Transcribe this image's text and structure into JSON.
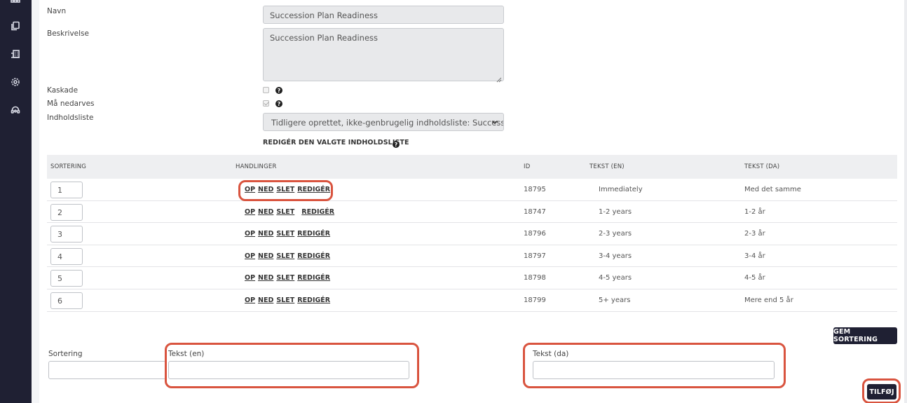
{
  "sidebar": {
    "icons": [
      "grid-icon",
      "documents-icon",
      "building-icon",
      "gear-icon",
      "support-icon"
    ]
  },
  "form": {
    "name_label": "Navn",
    "name_value": "Succession Plan Readiness",
    "description_label": "Beskrivelse",
    "description_value": "Succession Plan Readiness",
    "cascade_label": "Kaskade",
    "cascade_checked": false,
    "inheritable_label": "Må nedarves",
    "inheritable_checked": true,
    "content_list_label": "Indholdsliste",
    "content_list_value": "Tidligere oprettet, ikke-genbrugelig indholdsliste: Succession",
    "edit_list_link": "REDIGÉR DEN VALGTE INDHOLDSLISTE"
  },
  "table": {
    "headers": {
      "sort": "SORTERING",
      "actions": "HANDLINGER",
      "id": "ID",
      "text_en": "TEKST (EN)",
      "text_da": "TEKST (DA)"
    },
    "actions": {
      "up": "OP",
      "down": "NED",
      "delete": "SLET",
      "edit": "REDIGÉR"
    },
    "rows": [
      {
        "sort": "1",
        "id": "18795",
        "text_en": "Immediately",
        "text_da": "Med det samme"
      },
      {
        "sort": "2",
        "id": "18747",
        "text_en": "1-2 years",
        "text_da": "1-2 år"
      },
      {
        "sort": "3",
        "id": "18796",
        "text_en": "2-3 years",
        "text_da": "2-3 år"
      },
      {
        "sort": "4",
        "id": "18797",
        "text_en": "3-4 years",
        "text_da": "3-4 år"
      },
      {
        "sort": "5",
        "id": "18798",
        "text_en": "4-5 years",
        "text_da": "4-5 år"
      },
      {
        "sort": "6",
        "id": "18799",
        "text_en": "5+ years",
        "text_da": "Mere end 5 år"
      }
    ]
  },
  "save_sort_button": "GEM SORTERING",
  "add_form": {
    "sort_label": "Sortering",
    "text_en_label": "Tekst (en)",
    "text_da_label": "Tekst (da)",
    "add_button": "TILFØJ"
  },
  "colors": {
    "sidebar": "#1f2033",
    "highlight": "#d9543f"
  }
}
